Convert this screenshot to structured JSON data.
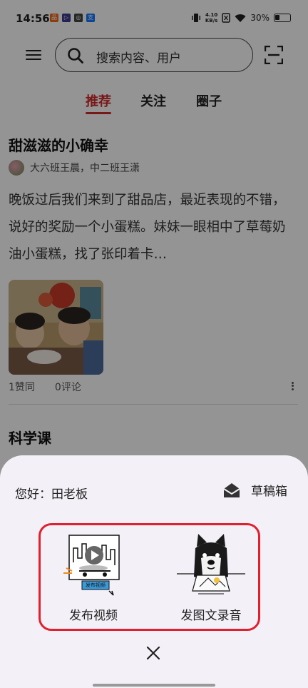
{
  "status_bar": {
    "time": "14:56",
    "net_speed_value": "4.10",
    "net_speed_unit": "KB/s",
    "battery": "30%",
    "app_icons": [
      {
        "name": "app-icon-orange",
        "color": "#f06a1c",
        "glyph": "品"
      },
      {
        "name": "app-icon-purple",
        "color": "#3d3c8e",
        "glyph": "▷"
      },
      {
        "name": "app-icon-dark",
        "color": "#444444",
        "glyph": "◎"
      },
      {
        "name": "app-icon-blue",
        "color": "#1677ff",
        "glyph": "支"
      }
    ]
  },
  "header": {
    "search_placeholder": "搜索内容、用户",
    "icons": [
      "menu-icon",
      "search-icon",
      "scan-icon"
    ]
  },
  "tabs": [
    {
      "label": "推荐",
      "active": true
    },
    {
      "label": "关注",
      "active": false
    },
    {
      "label": "圈子",
      "active": false
    }
  ],
  "feed": {
    "posts": [
      {
        "title": "甜滋滋的小确幸",
        "author": "大六班王晨，中二班王潇",
        "body": "晚饭过后我们来到了甜品店，最近表现的不错，说好的奖励一个小蛋糕。妹妹一眼相中了草莓奶油小蛋糕，找了张印着卡…",
        "likes": "1赞同",
        "comments": "0评论"
      },
      {
        "title": "科学课"
      }
    ]
  },
  "sheet": {
    "greeting": "您好：田老板",
    "drafts_label": "草稿箱",
    "video_badge": "发布视频",
    "options": [
      {
        "label": "发布视频",
        "icon": "video-skateboard-icon"
      },
      {
        "label": "发图文录音",
        "icon": "dog-drawing-icon"
      }
    ],
    "highlight_color": "#e0202e"
  },
  "colors": {
    "accent": "#d02a2a",
    "scrim": "rgba(0,0,0,0.42)",
    "sheet_bg": "#f4f0f7"
  }
}
